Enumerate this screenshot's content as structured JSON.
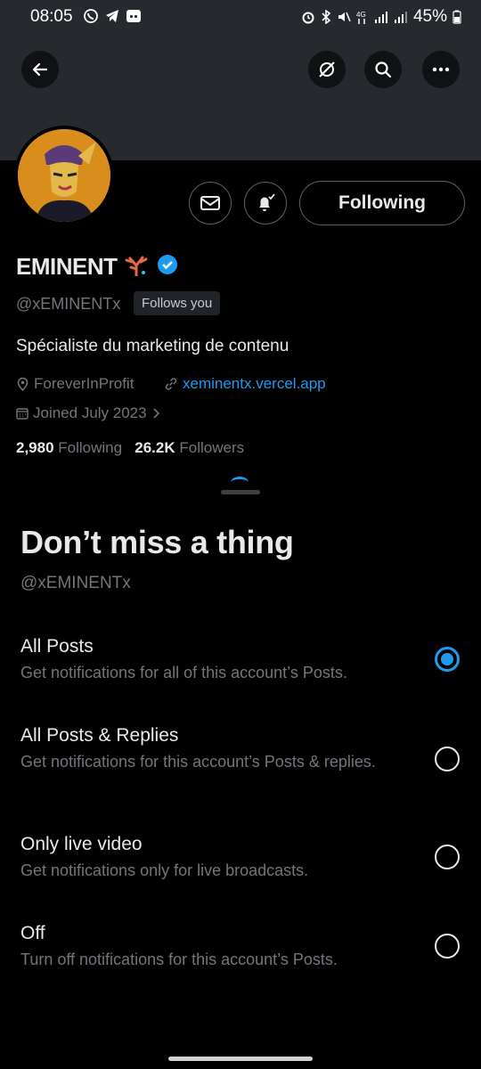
{
  "status_bar": {
    "time": "08:05",
    "battery": "45%"
  },
  "header": {
    "back_icon": "arrow-left-icon",
    "nosearch_icon": "eye-slash-icon",
    "search_icon": "search-icon",
    "more_icon": "more-horizontal-icon"
  },
  "profile": {
    "display_name": "EMINENT",
    "handle": "@xEMINENTx",
    "follows_you": "Follows you",
    "bio": "Spécialiste du marketing de contenu",
    "location": "ForeverInProfit",
    "website": "xeminentx.vercel.app",
    "joined": "Joined July 2023",
    "following_count": "2,980",
    "following_label": "Following",
    "followers_count": "26.2K",
    "followers_label": "Followers",
    "following_button": "Following"
  },
  "sheet": {
    "title": "Don’t miss a thing",
    "subtitle": "@xEMINENTx",
    "options": [
      {
        "title": "All Posts",
        "desc": "Get notifications for all of this account’s Posts.",
        "selected": true
      },
      {
        "title": "All Posts & Replies",
        "desc": "Get notifications for this account’s Posts & replies.",
        "selected": false
      },
      {
        "title": "Only live video",
        "desc": "Get notifications only for live broadcasts.",
        "selected": false
      },
      {
        "title": "Off",
        "desc": "Turn off notifications for this account’s Posts.",
        "selected": false
      }
    ]
  },
  "colors": {
    "accent": "#1d9bf0",
    "background": "#000000",
    "header": "#262a2f"
  }
}
